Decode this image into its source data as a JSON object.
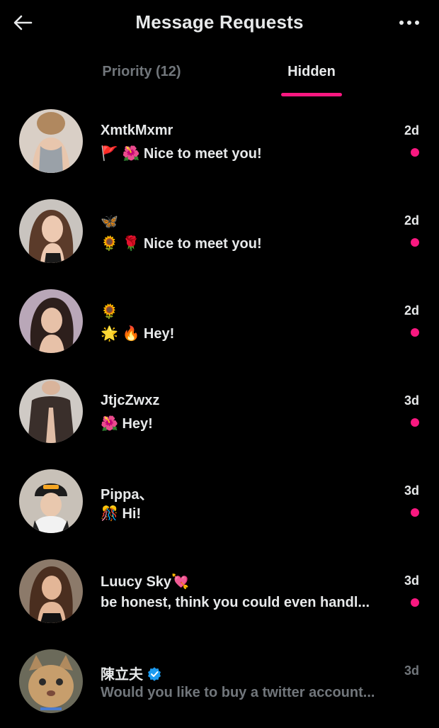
{
  "header": {
    "title": "Message Requests",
    "back_icon": "arrow-left-icon",
    "more_icon": "more-horizontal-icon"
  },
  "tabs": [
    {
      "label": "Priority (12)",
      "active": false
    },
    {
      "label": "Hidden",
      "active": true
    }
  ],
  "colors": {
    "accent": "#f91880",
    "text": "#e7e9ea",
    "muted": "#71767b",
    "background": "#000000",
    "verified": "#1d9bf0"
  },
  "messages": [
    {
      "name": "XmtkMxmr",
      "preview": "🚩 🌺 Nice to meet you!",
      "time": "2d",
      "unread": true
    },
    {
      "name": "🦋",
      "preview": "🌻 🌹 Nice to meet you!",
      "time": "2d",
      "unread": true
    },
    {
      "name": "🌻",
      "preview": "🌟 🔥 Hey!",
      "time": "2d",
      "unread": true
    },
    {
      "name": "JtjcZwxz",
      "preview": "🌺 Hey!",
      "time": "3d",
      "unread": true
    },
    {
      "name": "Pippa、",
      "preview": "🎊 Hi!",
      "time": "3d",
      "unread": true
    },
    {
      "name": "Luucy Sky💘",
      "preview": "be honest, think you could even handl...",
      "time": "3d",
      "unread": true
    },
    {
      "name": "陳立夫",
      "preview": "Would you like to buy a twitter account...",
      "time": "3d",
      "unread": false,
      "verified": true
    }
  ]
}
